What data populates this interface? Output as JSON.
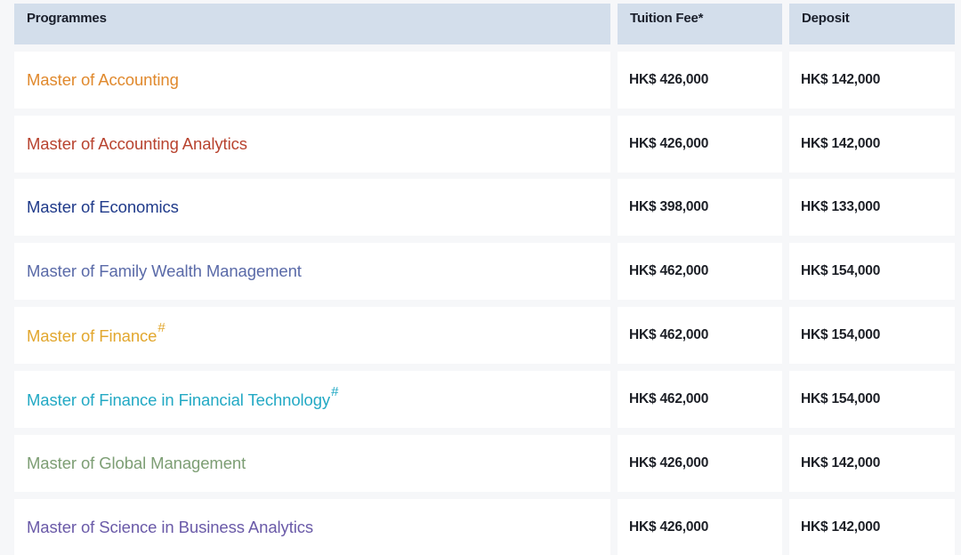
{
  "header": {
    "programmes": "Programmes",
    "tuition_fee": "Tuition Fee*",
    "deposit": "Deposit"
  },
  "rows": [
    {
      "programme": "Master of Accounting",
      "mark": "",
      "color": "#e0892d",
      "tuition": "HK$ 426,000",
      "deposit": "HK$ 142,000"
    },
    {
      "programme": "Master of Accounting Analytics",
      "mark": "",
      "color": "#b8432f",
      "tuition": "HK$ 426,000",
      "deposit": "HK$ 142,000"
    },
    {
      "programme": "Master of Economics",
      "mark": "",
      "color": "#1f3a8a",
      "tuition": "HK$ 398,000",
      "deposit": "HK$ 133,000"
    },
    {
      "programme": "Master of Family Wealth Management",
      "mark": "",
      "color": "#5a6aa8",
      "tuition": "HK$ 462,000",
      "deposit": "HK$ 154,000"
    },
    {
      "programme": "Master of Finance",
      "mark": "#",
      "color": "#e2a72e",
      "tuition": "HK$ 462,000",
      "deposit": "HK$ 154,000"
    },
    {
      "programme": "Master of Finance in Financial Technology",
      "mark": "#",
      "color": "#23a9c4",
      "tuition": "HK$ 462,000",
      "deposit": "HK$ 154,000"
    },
    {
      "programme": "Master of Global Management",
      "mark": "",
      "color": "#7d9e74",
      "tuition": "HK$ 426,000",
      "deposit": "HK$ 142,000"
    },
    {
      "programme": "Master of Science in Business Analytics",
      "mark": "",
      "color": "#6a5aa8",
      "tuition": "HK$ 426,000",
      "deposit": "HK$ 142,000"
    }
  ]
}
